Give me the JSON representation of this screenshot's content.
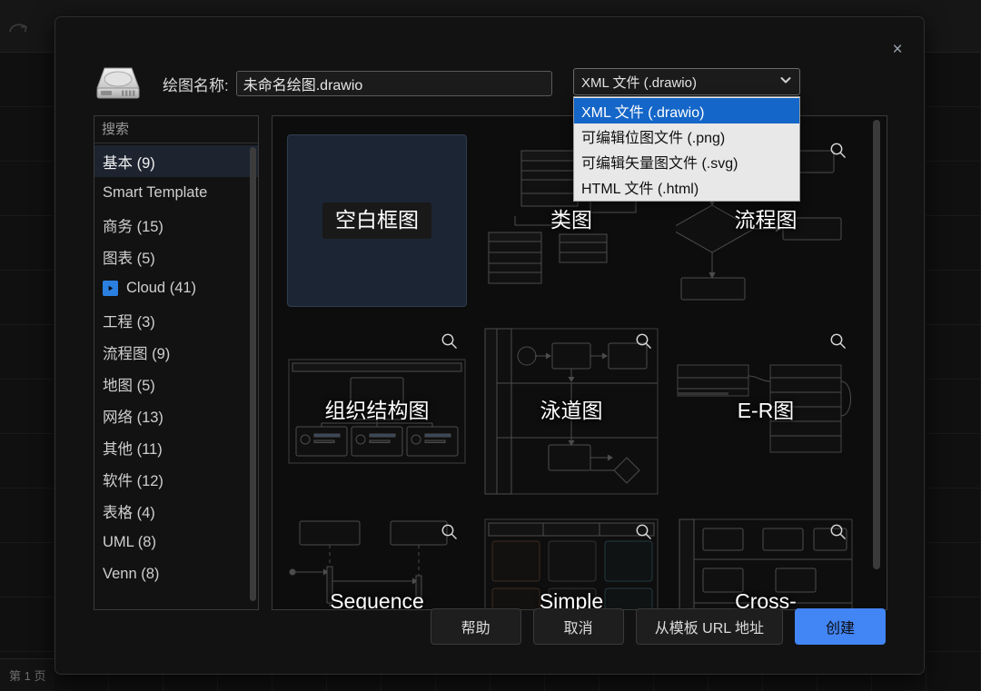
{
  "app": {
    "page_tab_label": "第 1 页",
    "redo_icon": "redo-icon"
  },
  "dialog": {
    "close_label": "×",
    "drive_icon": "drive-icon",
    "filename_label": "绘图名称:",
    "filename_value": "未命名绘图.drawio"
  },
  "format_select": {
    "selected": "XML 文件 (.drawio)",
    "chevron_icon": "chevron-down-icon",
    "options": [
      {
        "label": "XML 文件 (.drawio)",
        "selected": true
      },
      {
        "label": "可编辑位图文件 (.png)",
        "selected": false
      },
      {
        "label": "可编辑矢量图文件 (.svg)",
        "selected": false
      },
      {
        "label": "HTML 文件 (.html)",
        "selected": false
      }
    ]
  },
  "search": {
    "placeholder": "搜索",
    "value": "",
    "icon": "search-icon"
  },
  "categories": [
    {
      "label": "基本 (9)",
      "active": true,
      "badge": false
    },
    {
      "label": "Smart Template",
      "active": false,
      "badge": false
    },
    {
      "label": "商务 (15)",
      "active": false,
      "badge": false
    },
    {
      "label": "图表 (5)",
      "active": false,
      "badge": false
    },
    {
      "label": "Cloud (41)",
      "active": false,
      "badge": true
    },
    {
      "label": "工程 (3)",
      "active": false,
      "badge": false
    },
    {
      "label": "流程图 (9)",
      "active": false,
      "badge": false
    },
    {
      "label": "地图 (5)",
      "active": false,
      "badge": false
    },
    {
      "label": "网络 (13)",
      "active": false,
      "badge": false
    },
    {
      "label": "其他 (11)",
      "active": false,
      "badge": false
    },
    {
      "label": "软件 (12)",
      "active": false,
      "badge": false
    },
    {
      "label": "表格 (4)",
      "active": false,
      "badge": false
    },
    {
      "label": "UML (8)",
      "active": false,
      "badge": false
    },
    {
      "label": "Venn (8)",
      "active": false,
      "badge": false
    }
  ],
  "templates": [
    {
      "label": "空白框图",
      "selected": true,
      "art": "blank",
      "zoom": false
    },
    {
      "label": "类图",
      "selected": false,
      "art": "class",
      "zoom": false
    },
    {
      "label": "流程图",
      "selected": false,
      "art": "flow",
      "zoom": true
    },
    {
      "label": "组织结构图",
      "selected": false,
      "art": "org",
      "zoom": true
    },
    {
      "label": "泳道图",
      "selected": false,
      "art": "swim",
      "zoom": true
    },
    {
      "label": "E-R图",
      "selected": false,
      "art": "er",
      "zoom": true
    },
    {
      "label": "Sequence",
      "selected": false,
      "art": "seq",
      "zoom": true
    },
    {
      "label": "Simple",
      "selected": false,
      "art": "simple",
      "zoom": true
    },
    {
      "label": "Cross-",
      "selected": false,
      "art": "cross",
      "zoom": true
    }
  ],
  "footer": {
    "help": "帮助",
    "cancel": "取消",
    "from_url": "从模板 URL 地址",
    "create": "创建"
  },
  "colors": {
    "accent": "#4285f4",
    "dropdown_highlight": "#1466c8",
    "dialog_bg": "#121212",
    "selected_card": "#1c2533"
  }
}
